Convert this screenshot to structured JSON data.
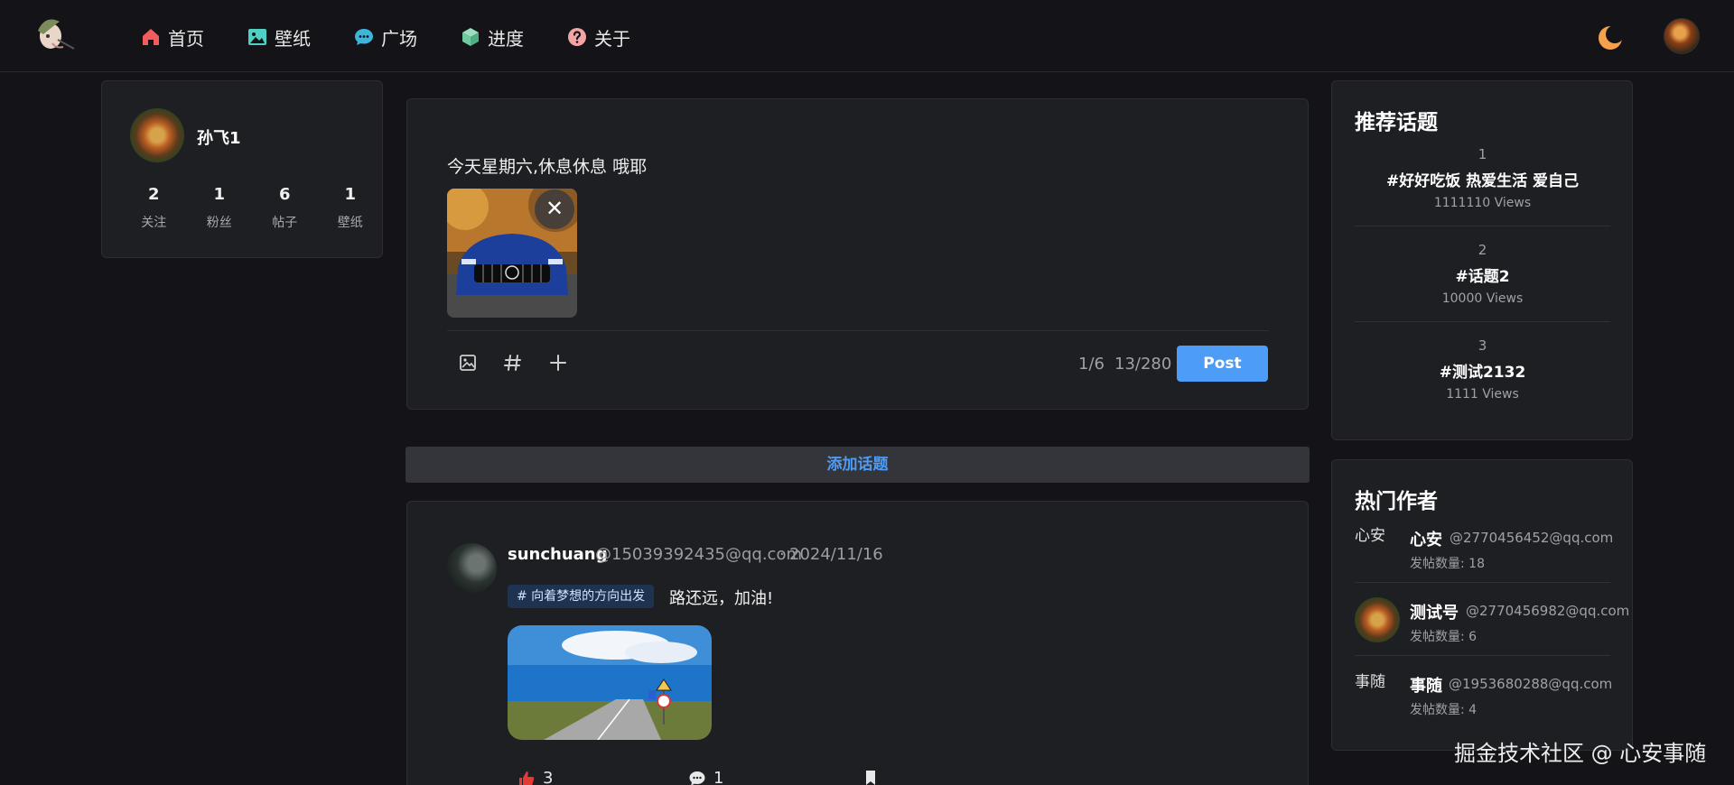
{
  "nav": {
    "items": [
      {
        "label": "首页",
        "icon": "home-icon",
        "color": "#f25c5c"
      },
      {
        "label": "壁纸",
        "icon": "image-icon",
        "color": "#4fd0c2"
      },
      {
        "label": "广场",
        "icon": "chat-icon",
        "color": "#3db4d8"
      },
      {
        "label": "进度",
        "icon": "cube-icon",
        "color": "#6fcba0"
      },
      {
        "label": "关于",
        "icon": "question-icon",
        "color": "#f2a5a5"
      }
    ]
  },
  "profile": {
    "name": "孙飞1",
    "stats": [
      {
        "num": "2",
        "label": "关注"
      },
      {
        "num": "1",
        "label": "粉丝"
      },
      {
        "num": "6",
        "label": "帖子"
      },
      {
        "num": "1",
        "label": "壁纸"
      }
    ]
  },
  "composer": {
    "text": "今天星期六,休息休息 哦耶",
    "close_symbol": "✕",
    "image_count": "1/6",
    "char_count": "13/280",
    "post_label": "Post"
  },
  "add_topic_label": "添加话题",
  "post": {
    "username": "sunchuang",
    "email": "@15039392435@qq.com",
    "separator": "·",
    "date": "2024/11/16",
    "tag": "# 向着梦想的方向出发",
    "text": "路还远，加油!",
    "likes": "3",
    "comments": "1"
  },
  "topics": {
    "title": "推荐话题",
    "items": [
      {
        "rank": "1",
        "name": "#好好吃饭 热爱生活 爱自己",
        "views": "1111110 Views"
      },
      {
        "rank": "2",
        "name": "#话题2",
        "views": "10000 Views"
      },
      {
        "rank": "3",
        "name": "#测试2132",
        "views": "1111 Views"
      }
    ]
  },
  "authors": {
    "title": "热门作者",
    "items": [
      {
        "alt": "心安",
        "name": "心安",
        "email": "@2770456452@qq.com",
        "count": "发帖数量: 18"
      },
      {
        "alt": "",
        "name": "测试号",
        "email": "@2770456982@qq.com",
        "count": "发帖数量: 6"
      },
      {
        "alt": "事随",
        "name": "事随",
        "email": "@1953680288@qq.com",
        "count": "发帖数量: 4"
      }
    ]
  },
  "watermark": "掘金技术社区 @ 心安事随",
  "colors": {
    "accent": "#4d9cf6",
    "like": "#e53935",
    "moon": "#f5a04a"
  }
}
